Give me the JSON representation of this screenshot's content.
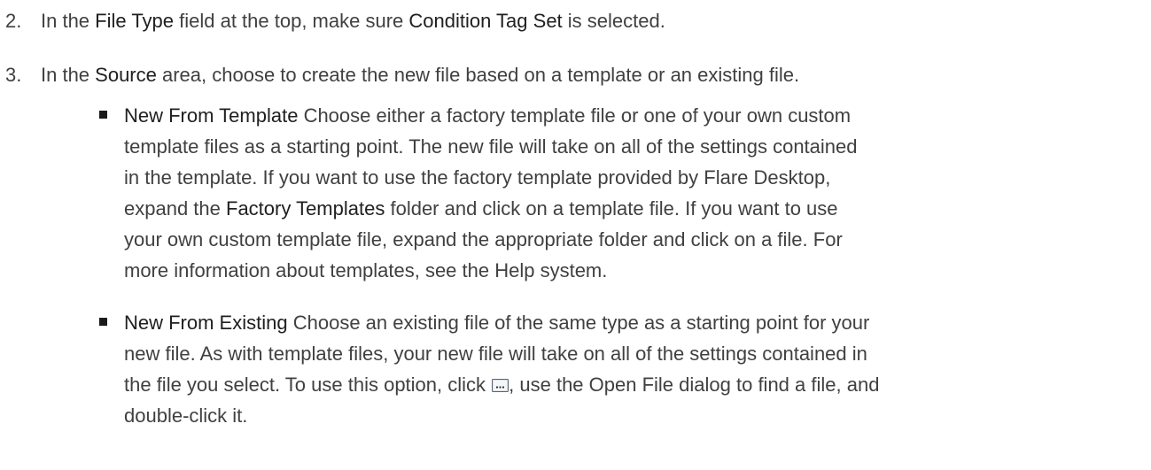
{
  "steps": [
    {
      "number": "2.",
      "parts": [
        {
          "text": "In the ",
          "em": false
        },
        {
          "text": "File Type",
          "em": true
        },
        {
          "text": " field at the top, make sure ",
          "em": false
        },
        {
          "text": "Condition Tag Set",
          "em": true
        },
        {
          "text": " is selected.",
          "em": false
        }
      ]
    },
    {
      "number": "3.",
      "parts": [
        {
          "text": "In the ",
          "em": false
        },
        {
          "text": "Source",
          "em": true
        },
        {
          "text": " area, choose to create the new file based on a template or an existing file.",
          "em": false
        }
      ]
    }
  ],
  "bullets": [
    {
      "title": "New From Template",
      "lines": [
        "Choose either a factory template file or one of your own custom",
        "template files as a starting point. The new file will take on all of the settings contained",
        "in the template. If you want to use the factory template provided by Flare Desktop,",
        "expand the",
        "Factory Templates",
        "folder and click on a template file. If you want to use",
        "your own custom template file, expand the appropriate folder and click on a file. For",
        "more information about templates, see the Help system."
      ]
    },
    {
      "title": "New From Existing",
      "lines": [
        "Choose an existing file of the same type as a starting point for your",
        "new file. As with template files, your new file will take on all of the settings contained in",
        "the file you select. To use this option, click",
        ", use the Open File dialog to find a file, and",
        "double-click it."
      ]
    }
  ]
}
